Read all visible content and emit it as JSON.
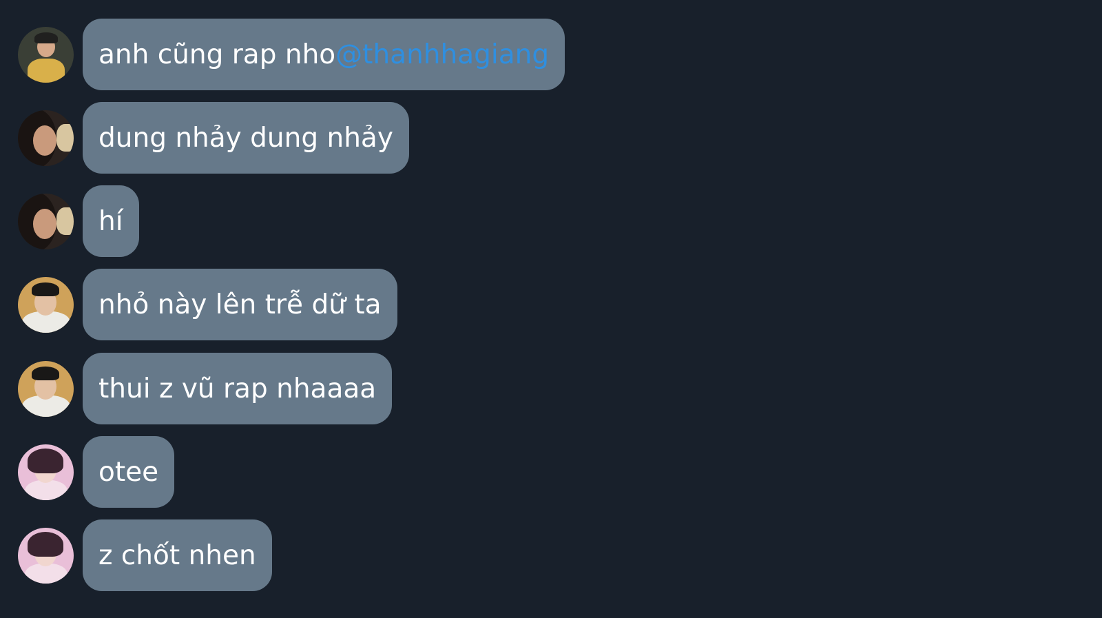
{
  "chat": {
    "messages": [
      {
        "avatar": "avatar-male-yellow-jacket",
        "text": "anh cũng rap nho ",
        "mention": "@thanhhagiang"
      },
      {
        "avatar": "avatar-female-dark-hair",
        "text": "dung nhảy dung nhảy",
        "mention": ""
      },
      {
        "avatar": "avatar-female-dark-hair",
        "text": "hí",
        "mention": ""
      },
      {
        "avatar": "avatar-male-glasses",
        "text": "nhỏ này lên trễ dữ ta",
        "mention": ""
      },
      {
        "avatar": "avatar-male-glasses",
        "text": "thui z vũ rap nhaaaa",
        "mention": ""
      },
      {
        "avatar": "avatar-pink-background",
        "text": "otee",
        "mention": ""
      },
      {
        "avatar": "avatar-pink-background",
        "text": "z chốt nhen",
        "mention": ""
      }
    ]
  },
  "colors": {
    "background": "#18202b",
    "bubble": "#66798a",
    "text": "#ffffff",
    "mention": "#2f8fe0"
  }
}
